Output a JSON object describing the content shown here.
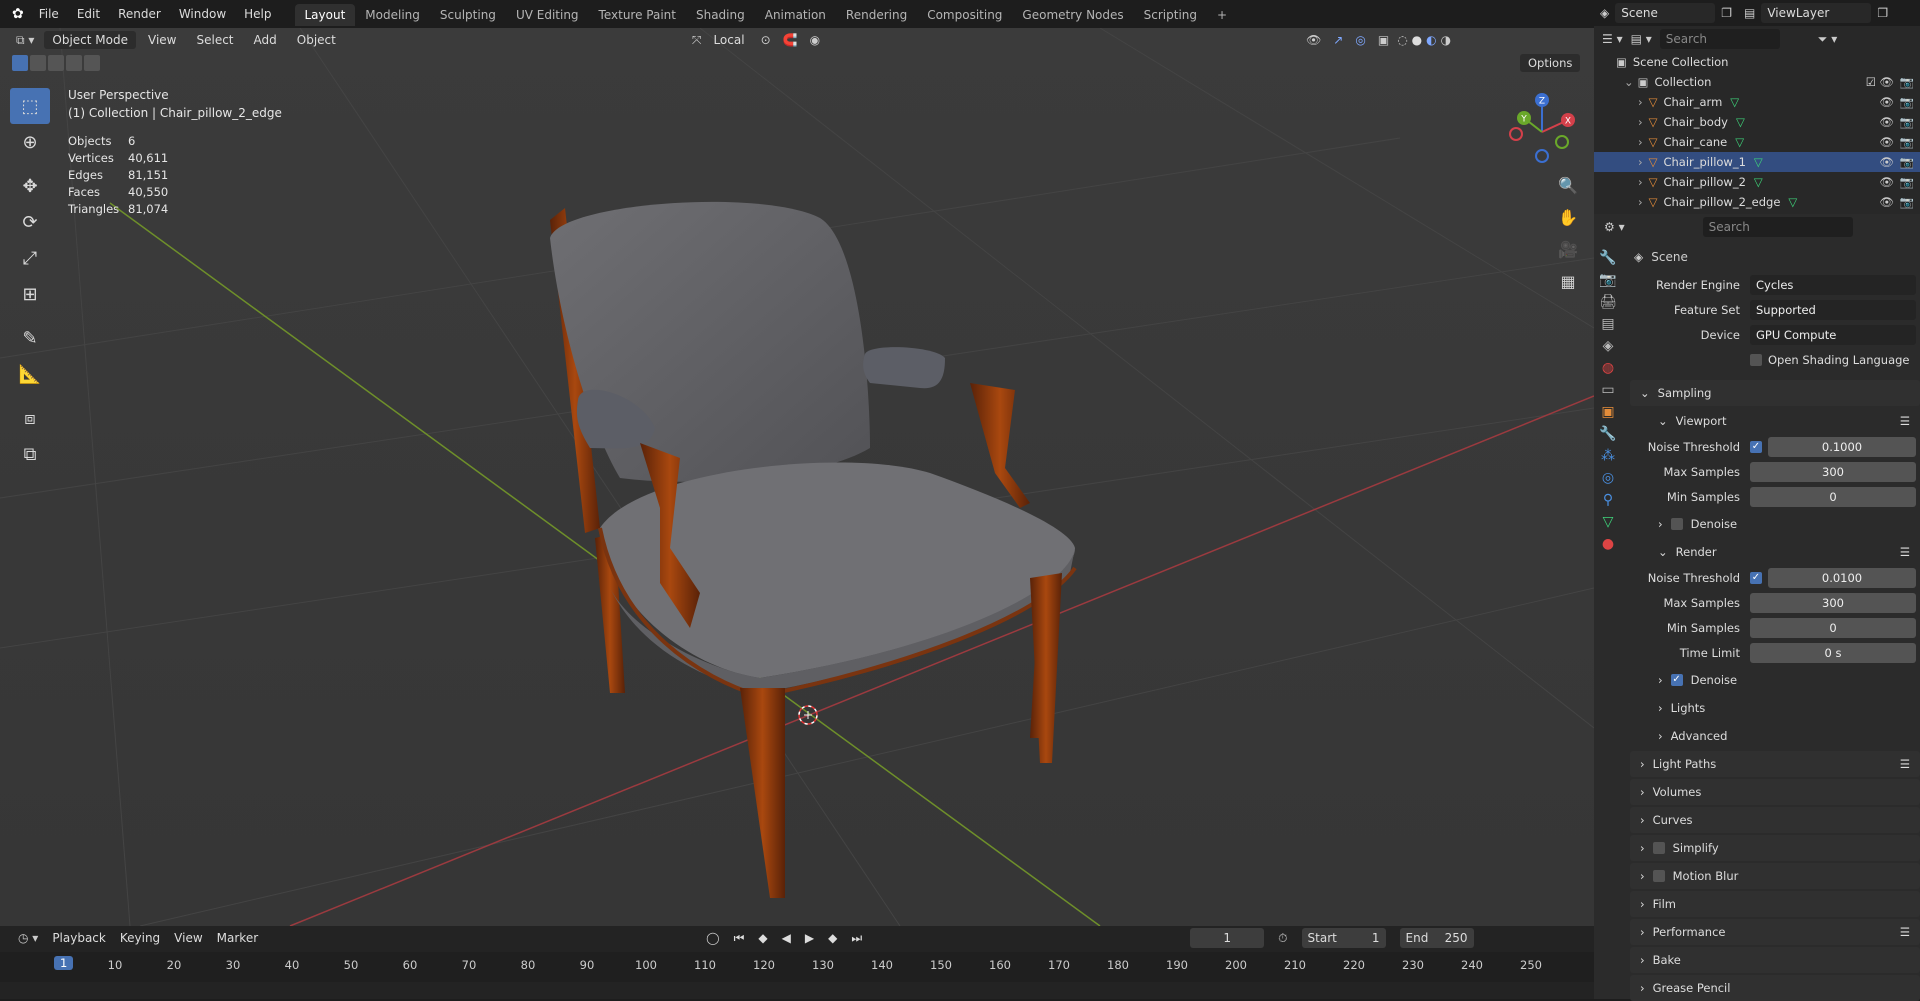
{
  "menus": [
    "File",
    "Edit",
    "Render",
    "Window",
    "Help"
  ],
  "workspaces": [
    "Layout",
    "Modeling",
    "Sculpting",
    "UV Editing",
    "Texture Paint",
    "Shading",
    "Animation",
    "Rendering",
    "Compositing",
    "Geometry Nodes",
    "Scripting"
  ],
  "top_right": {
    "scene": "Scene",
    "view_layer": "ViewLayer"
  },
  "viewport": {
    "mode": "Object Mode",
    "menus": [
      "View",
      "Select",
      "Add",
      "Object"
    ],
    "transform": "Local",
    "options_label": "Options",
    "perspective": "User Perspective",
    "context": "(1) Collection | Chair_pillow_2_edge",
    "stats": [
      {
        "label": "Objects",
        "value": "6"
      },
      {
        "label": "Vertices",
        "value": "40,611"
      },
      {
        "label": "Edges",
        "value": "81,151"
      },
      {
        "label": "Faces",
        "value": "40,550"
      },
      {
        "label": "Triangles",
        "value": "81,074"
      }
    ],
    "gizmo": {
      "x": "X",
      "y": "Y",
      "z": "Z"
    }
  },
  "outliner": {
    "search_placeholder": "Search",
    "root": "Scene Collection",
    "collection": "Collection",
    "items": [
      {
        "name": "Chair_arm",
        "selected": false
      },
      {
        "name": "Chair_body",
        "selected": false
      },
      {
        "name": "Chair_cane",
        "selected": false
      },
      {
        "name": "Chair_pillow_1",
        "selected": true
      },
      {
        "name": "Chair_pillow_2",
        "selected": false
      },
      {
        "name": "Chair_pillow_2_edge",
        "selected": false
      }
    ]
  },
  "properties": {
    "search_placeholder": "Search",
    "title": "Scene",
    "render_engine_label": "Render Engine",
    "render_engine": "Cycles",
    "feature_set_label": "Feature Set",
    "feature_set": "Supported",
    "device_label": "Device",
    "device": "GPU Compute",
    "osl_label": "Open Shading Language",
    "sampling": "Sampling",
    "viewport": "Viewport",
    "vp_noise_label": "Noise Threshold",
    "vp_noise": "0.1000",
    "vp_max_label": "Max Samples",
    "vp_max": "300",
    "vp_min_label": "Min Samples",
    "vp_min": "0",
    "denoise": "Denoise",
    "render": "Render",
    "r_noise_label": "Noise Threshold",
    "r_noise": "0.0100",
    "r_max_label": "Max Samples",
    "r_max": "300",
    "r_min_label": "Min Samples",
    "r_min": "0",
    "r_time_label": "Time Limit",
    "r_time": "0 s",
    "r_denoise": "Denoise",
    "lights": "Lights",
    "advanced": "Advanced",
    "sections": [
      "Light Paths",
      "Volumes",
      "Curves",
      "Simplify",
      "Motion Blur",
      "Film",
      "Performance",
      "Bake",
      "Grease Pencil"
    ]
  },
  "timeline": {
    "menus": [
      "Playback",
      "Keying",
      "View",
      "Marker"
    ],
    "current_frame": "1",
    "start_label": "Start",
    "start": "1",
    "end_label": "End",
    "end": "250",
    "ticks": [
      "10",
      "20",
      "30",
      "40",
      "50",
      "60",
      "70",
      "80",
      "90",
      "100",
      "110",
      "120",
      "130",
      "140",
      "150",
      "160",
      "170",
      "180",
      "190",
      "200",
      "210",
      "220",
      "230",
      "240",
      "250"
    ]
  }
}
